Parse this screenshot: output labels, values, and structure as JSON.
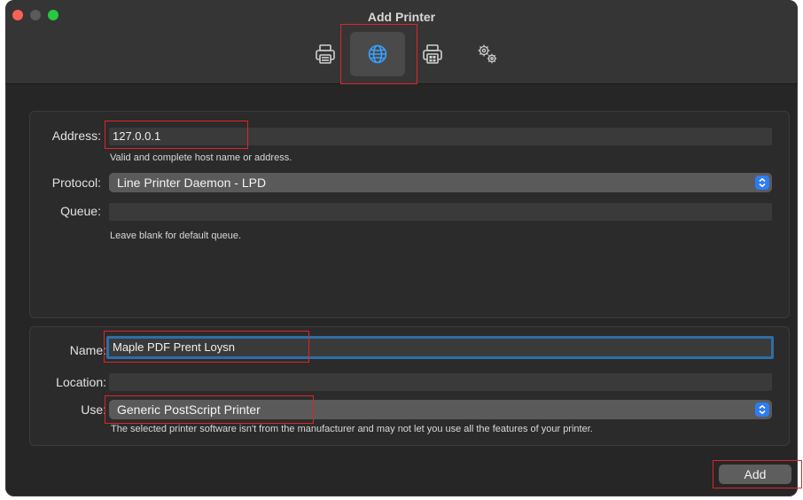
{
  "window": {
    "title": "Add Printer"
  },
  "toolbar": {
    "items": [
      {
        "icon": "printer-icon"
      },
      {
        "icon": "globe-icon",
        "selected": true
      },
      {
        "icon": "windows-printer-icon"
      },
      {
        "icon": "gears-icon"
      }
    ]
  },
  "network": {
    "address_label": "Address:",
    "address_value": "127.0.0.1",
    "address_hint": "Valid and complete host name or address.",
    "protocol_label": "Protocol:",
    "protocol_value": "Line Printer Daemon - LPD",
    "queue_label": "Queue:",
    "queue_value": "",
    "queue_hint": "Leave blank for default queue."
  },
  "printer": {
    "name_label": "Name:",
    "name_value": "Maple PDF Prent Loysn",
    "location_label": "Location:",
    "location_value": "",
    "use_label": "Use:",
    "use_value": "Generic PostScript Printer",
    "use_hint": "The selected printer software isn't from the manufacturer and may not let you use all the features of your printer."
  },
  "actions": {
    "add_label": "Add"
  },
  "colors": {
    "accent": "#2d7cf6",
    "highlight": "#e0242a",
    "focus_ring": "#2c6fa6"
  }
}
